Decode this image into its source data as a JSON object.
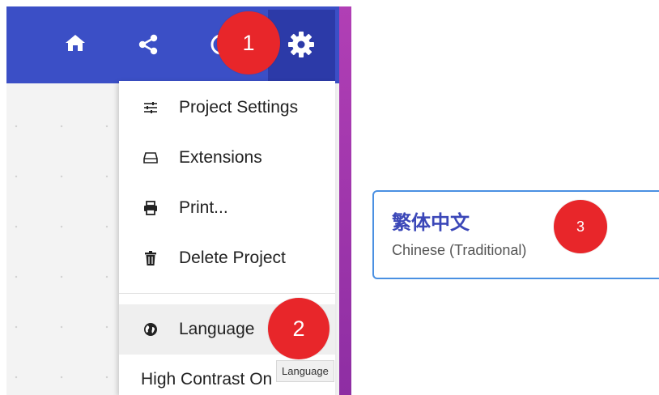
{
  "header": {
    "icons": [
      "home-icon",
      "share-icon",
      "help-icon",
      "gear-icon"
    ],
    "header_color": "#3b4fc6",
    "gear_tab_color": "#2c3aa8"
  },
  "menu": {
    "items": [
      {
        "label": "Project Settings",
        "icon": "sliders-icon"
      },
      {
        "label": "Extensions",
        "icon": "drive-icon"
      },
      {
        "label": "Print...",
        "icon": "print-icon"
      },
      {
        "label": "Delete Project",
        "icon": "trash-icon"
      },
      {
        "label": "Language",
        "icon": "globe-icon"
      },
      {
        "label": "High Contrast On",
        "icon": ""
      }
    ]
  },
  "tooltip": {
    "text": "Language"
  },
  "badges": {
    "one": "1",
    "two": "2",
    "three": "3",
    "color": "#e8262a"
  },
  "language_option": {
    "native": "繁体中文",
    "english": "Chinese (Traditional)",
    "border_color": "#4a90e2"
  }
}
